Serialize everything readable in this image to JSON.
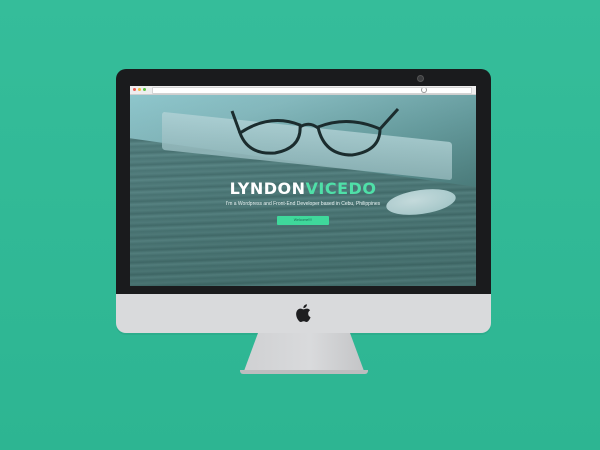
{
  "colors": {
    "background": "#2fb896",
    "accent": "#4fe0a8",
    "button": "#3fd89b"
  },
  "device": {
    "type": "desktop-monitor",
    "logo_icon": "apple-logo-icon"
  },
  "site": {
    "brand_first": "LYNDON",
    "brand_last": "VICEDO",
    "tagline": "I'm a Wordpress and Front-End Developer based in Cebu, Philippines",
    "cta_label": "Welcome!!!!"
  }
}
